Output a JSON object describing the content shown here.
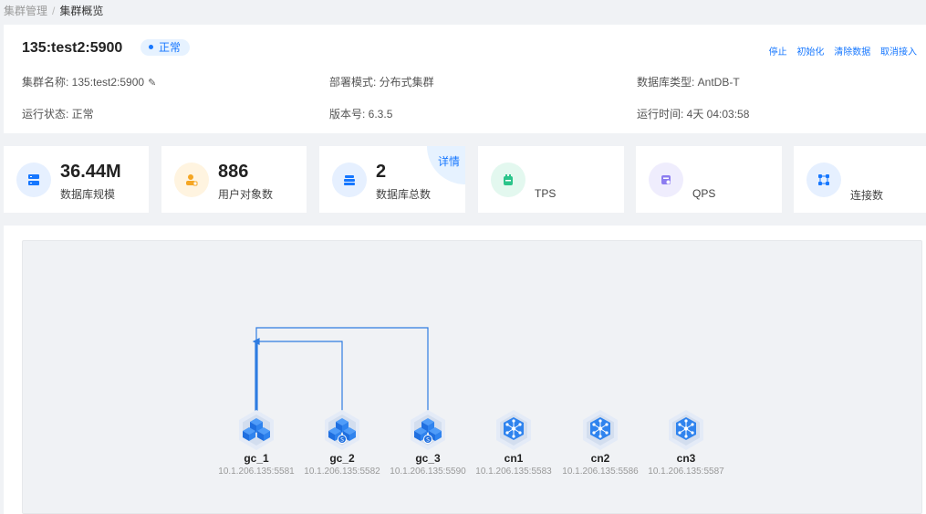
{
  "breadcrumb": {
    "parent": "集群管理",
    "separator": "/",
    "current": "集群概览"
  },
  "cluster": {
    "title": "135:test2:5900",
    "status": "正常",
    "actions": [
      "停止",
      "初始化",
      "清除数据",
      "取消接入"
    ],
    "fields": {
      "name_label": "集群名称: ",
      "name_value": "135:test2:5900",
      "deploy_label": "部署模式: ",
      "deploy_value": "分布式集群",
      "dbtype_label": "数据库类型: ",
      "dbtype_value": "AntDB-T",
      "runstate_label": "运行状态: ",
      "runstate_value": "正常",
      "version_label": "版本号: ",
      "version_value": "6.3.5",
      "uptime_label": "运行时间: ",
      "uptime_value": "4天 04:03:58"
    }
  },
  "metrics": [
    {
      "value": "36.44M",
      "label": "数据库规模",
      "icon": "database-scale-icon",
      "color": "#1677ff",
      "bg": "#e6f0ff"
    },
    {
      "value": "886",
      "label": "用户对象数",
      "icon": "user-objects-icon",
      "color": "#f5a623",
      "bg": "#fff4e0"
    },
    {
      "value": "2",
      "label": "数据库总数",
      "icon": "database-count-icon",
      "color": "#1677ff",
      "bg": "#e6f0ff",
      "detail": "详情"
    },
    {
      "value": "",
      "label": "TPS",
      "icon": "tps-icon",
      "color": "#2bc48a",
      "bg": "#e3f8ef"
    },
    {
      "value": "",
      "label": "QPS",
      "icon": "qps-icon",
      "color": "#8c7cf0",
      "bg": "#efedfd"
    },
    {
      "value": "",
      "label": "连接数",
      "icon": "connections-icon",
      "color": "#1677ff",
      "bg": "#e6f0ff"
    }
  ],
  "topology": {
    "nodes": [
      {
        "name": "gc_1",
        "addr": "10.1.206.135:5581",
        "kind": "gc",
        "badge": ""
      },
      {
        "name": "gc_2",
        "addr": "10.1.206.135:5582",
        "kind": "gc",
        "badge": "S"
      },
      {
        "name": "gc_3",
        "addr": "10.1.206.135:5590",
        "kind": "gc",
        "badge": "S"
      },
      {
        "name": "cn1",
        "addr": "10.1.206.135:5583",
        "kind": "cn",
        "badge": ""
      },
      {
        "name": "cn2",
        "addr": "10.1.206.135:5586",
        "kind": "cn",
        "badge": ""
      },
      {
        "name": "cn3",
        "addr": "10.1.206.135:5587",
        "kind": "cn",
        "badge": ""
      }
    ],
    "link_color": "#2f7de1"
  }
}
